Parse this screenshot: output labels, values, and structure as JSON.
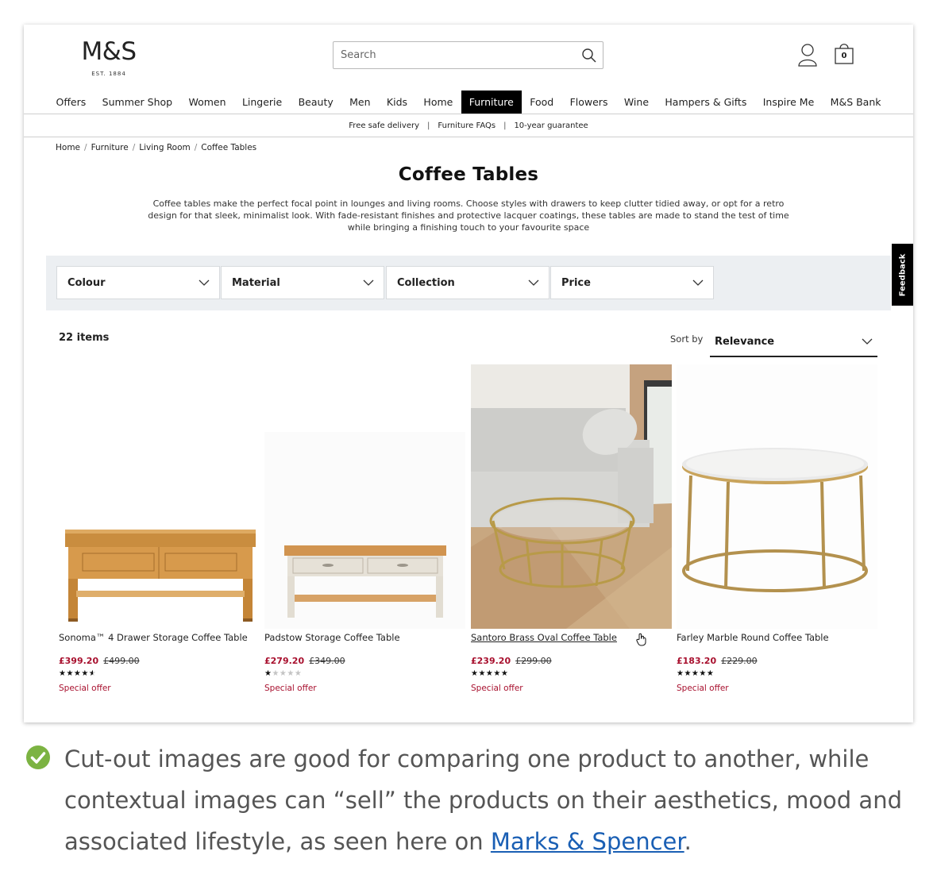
{
  "header": {
    "logo": "M&S",
    "logo_tagline": "EST. 1884",
    "search_placeholder": "Search",
    "bag_count": "0"
  },
  "nav": {
    "items": [
      "Offers",
      "Summer Shop",
      "Women",
      "Lingerie",
      "Beauty",
      "Men",
      "Kids",
      "Home",
      "Furniture",
      "Food",
      "Flowers",
      "Wine",
      "Hampers & Gifts",
      "Inspire Me",
      "M&S Bank"
    ],
    "active": "Furniture"
  },
  "promo_bar": {
    "items": [
      "Free safe delivery",
      "Furniture FAQs",
      "10-year guarantee"
    ]
  },
  "breadcrumb": [
    "Home",
    "Furniture",
    "Living Room",
    "Coffee Tables"
  ],
  "page": {
    "title": "Coffee Tables",
    "description": "Coffee tables make the perfect focal point in lounges and living rooms. Choose styles with drawers to keep clutter tidied away, or opt for a retro design for that sleek, minimalist look. With fade-resistant finishes and protective lacquer coatings, these tables are made to stand the test of time while bringing a finishing touch to your favourite space"
  },
  "filters": [
    "Colour",
    "Material",
    "Collection",
    "Price"
  ],
  "feedback_label": "Feedback",
  "results": {
    "count_label": "22 items",
    "sort_label": "Sort by",
    "sort_value": "Relevance"
  },
  "products": [
    {
      "name": "Sonoma™ 4 Drawer Storage Coffee Table",
      "price": "£399.20",
      "was_price": "£499.00",
      "rating": 4.5,
      "offer": "Special offer"
    },
    {
      "name": "Padstow Storage Coffee Table",
      "price": "£279.20",
      "was_price": "£349.00",
      "rating": 1,
      "offer": "Special offer"
    },
    {
      "name": "Santoro Brass Oval Coffee Table",
      "price": "£239.20",
      "was_price": "£299.00",
      "rating": 5,
      "offer": "Special offer"
    },
    {
      "name": "Farley Marble Round Coffee Table",
      "price": "£183.20",
      "was_price": "£229.00",
      "rating": 5,
      "offer": "Special offer"
    }
  ],
  "caption": {
    "text": "Cut-out images are good for comparing one product to another, while contextual images can “sell” the products on their aesthetics, mood and associated lifestyle, as seen here on ",
    "link_text": "Marks & Spencer",
    "end": "."
  },
  "colors": {
    "price_red": "#a8102e",
    "link_blue": "#1a5fb4",
    "check_green": "#7cb342"
  }
}
